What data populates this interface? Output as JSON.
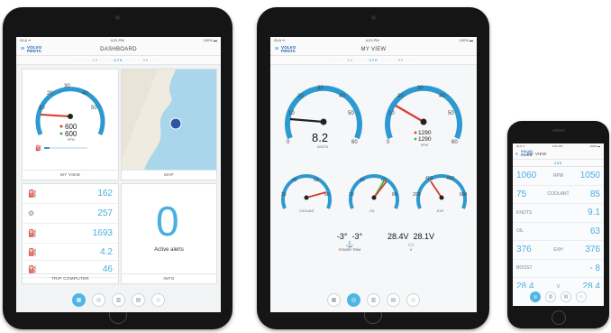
{
  "status": {
    "carrier": "GLA ᯤ",
    "time": "4:21 PM",
    "battery": "100% ▬"
  },
  "heading": {
    "left": "· · · · · 24 · · · ·",
    "value": "270",
    "right": "· · · · · 30 · · · ·",
    "short_value": "290"
  },
  "colors": {
    "accent": "#4aaee0",
    "needle_red": "#d93a2b",
    "needle_dark": "#222222",
    "green": "#3bb54a"
  },
  "ipad1": {
    "nav_title": "DASHBOARD",
    "logo": "VOLVO\nPENTA",
    "gauge": {
      "ticks": [
        "10",
        "20",
        "30",
        "40",
        "50",
        "0",
        "60"
      ],
      "val1": "600",
      "val2": "600",
      "unit": "RPM",
      "level": 0.12
    },
    "cards": {
      "my_view": "MY VIEW",
      "map": "MAP",
      "trip": "TRIP COMPUTER",
      "info": "INFO"
    },
    "trip_rows": [
      {
        "icon": "⛽",
        "sub": "SCORE",
        "value": "162"
      },
      {
        "icon": "⚙",
        "sub": "",
        "value": "257"
      },
      {
        "icon": "⛽",
        "sub": "",
        "value": "1693"
      },
      {
        "icon": "⛽",
        "sub": "L/H",
        "value": "4.2"
      },
      {
        "icon": "⛽",
        "sub": "",
        "value": "46"
      }
    ],
    "alerts": {
      "count": "0",
      "label": "Active alerts"
    },
    "tabs": [
      "▦",
      "◎",
      "▥",
      "▤",
      "◇"
    ]
  },
  "ipad2": {
    "nav_title": "MY VIEW",
    "speed": {
      "ticks": [
        "10",
        "20",
        "30",
        "40",
        "50",
        "0",
        "60"
      ],
      "value": "8.2",
      "unit": "KNOTS",
      "level": 0.14
    },
    "rpm": {
      "ticks": [
        "10",
        "20",
        "30",
        "40",
        "50",
        "0",
        "60"
      ],
      "val1": "1290",
      "val2": "1290",
      "unit": "RPM",
      "level": 0.3
    },
    "small1": {
      "ticks": [
        "20",
        "40",
        "60",
        "80"
      ],
      "label": "COOLANT"
    },
    "small2": {
      "ticks": [
        "20",
        "40",
        "60",
        "80"
      ],
      "label": "OIL"
    },
    "small3": {
      "ticks": [
        "400",
        "600",
        "200",
        "800"
      ],
      "label": "EXH"
    },
    "trim": {
      "v1": "-3°",
      "v2": "-3°",
      "label": "POWER TRIM"
    },
    "volt": {
      "v1": "28.4V",
      "v2": "28.1V",
      "label": "V"
    },
    "tabs": [
      "▦",
      "◎",
      "▥",
      "▤",
      "◇"
    ]
  },
  "iphone": {
    "nav_title": "MY VIEW",
    "heading": "290",
    "rows": [
      {
        "left": "1060",
        "icon": "RPM",
        "right": "1050"
      },
      {
        "left": "75",
        "icon": "COOLANT",
        "right": "85"
      },
      {
        "left": "",
        "icon": "KNOTS",
        "right": "9.1"
      },
      {
        "left": "",
        "icon": "OIL",
        "right": "63"
      },
      {
        "left": "376",
        "icon": "EXH",
        "right": "376"
      },
      {
        "left": "",
        "icon": "BOOST",
        "right": "- 8"
      },
      {
        "left": "28.4",
        "icon": "V",
        "right": "28.4"
      }
    ],
    "tabs": [
      "◎",
      "▥",
      "▤",
      "◇"
    ]
  }
}
